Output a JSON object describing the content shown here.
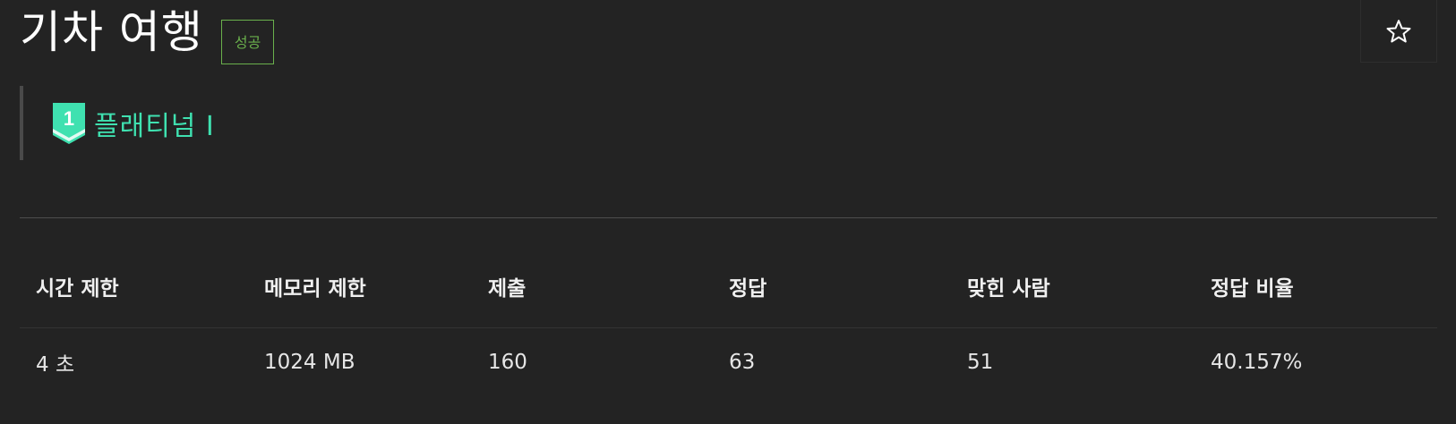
{
  "problem": {
    "title": "기차 여행",
    "result_badge": "성공"
  },
  "favorite": {
    "icon": "star-outline-icon",
    "glyph": "☆"
  },
  "tier": {
    "number": "1",
    "label": "플래티넘 I",
    "color": "#3fe1b0"
  },
  "stats": {
    "headers": [
      "시간 제한",
      "메모리 제한",
      "제출",
      "정답",
      "맞힌 사람",
      "정답 비율"
    ],
    "values": [
      "4 초",
      "1024 MB",
      "160",
      "63",
      "51",
      "40.157%"
    ]
  },
  "colors": {
    "background": "#232323",
    "success": "#6ab04c",
    "platinum": "#3fe1b0"
  }
}
